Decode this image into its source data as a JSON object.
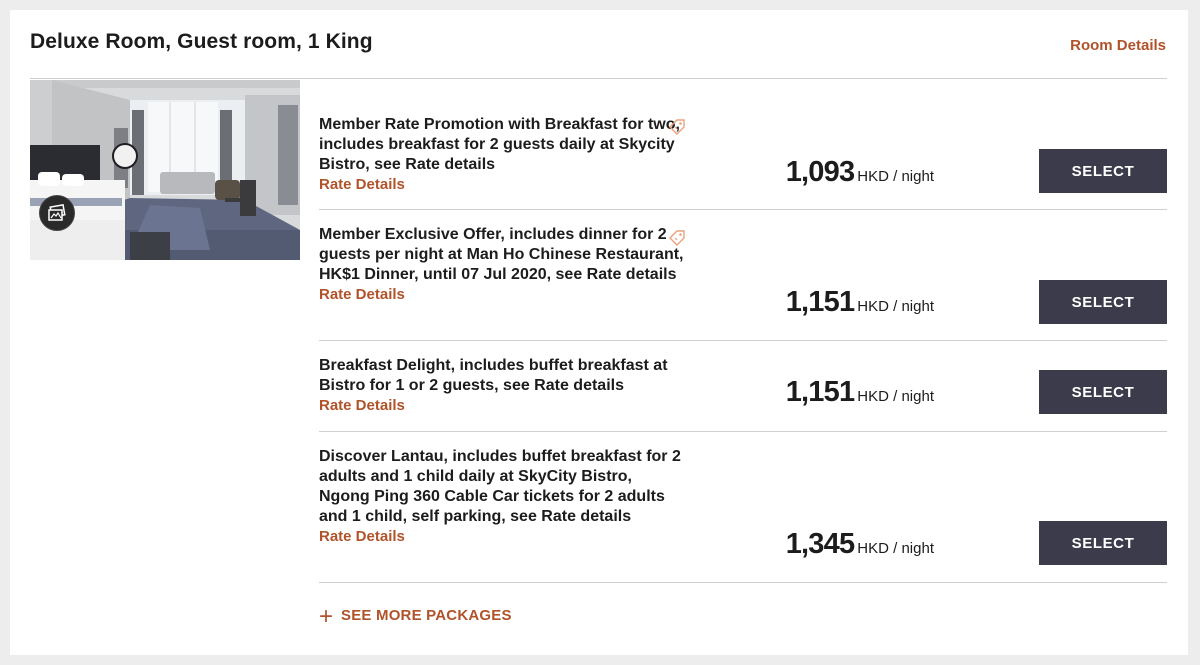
{
  "room": {
    "title": "Deluxe Room, Guest room, 1 King",
    "details_link": "Room Details",
    "photo_icon": "gallery-icon"
  },
  "rates": [
    {
      "description": "Member Rate Promotion with Breakfast for two, includes breakfast for 2 guests daily at Skycity Bistro, see Rate details",
      "link": "Rate Details",
      "has_tag": true,
      "price": "1,093",
      "unit": "HKD / night",
      "button": "SELECT"
    },
    {
      "description": "Member Exclusive Offer, includes dinner for 2 guests per night at Man Ho Chinese Restaurant, HK$1 Dinner, until 07 Jul 2020, see Rate details",
      "link": "Rate Details",
      "has_tag": true,
      "price": "1,151",
      "unit": "HKD / night",
      "button": "SELECT"
    },
    {
      "description": "Breakfast Delight, includes buffet breakfast at Bistro for 1 or 2 guests, see Rate details",
      "link": "Rate Details",
      "has_tag": false,
      "price": "1,151",
      "unit": "HKD / night",
      "button": "SELECT"
    },
    {
      "description": "Discover Lantau, includes buffet breakfast for 2 adults and 1 child daily at SkyCity Bistro, Ngong Ping 360 Cable Car tickets for 2 adults and 1 child, self parking, see Rate details",
      "link": "Rate Details",
      "has_tag": false,
      "price": "1,345",
      "unit": "HKD / night",
      "button": "SELECT"
    }
  ],
  "see_more": {
    "icon": "plus-icon",
    "label": "SEE MORE PACKAGES"
  },
  "colors": {
    "accent": "#b0532a",
    "button": "#3c3b4c",
    "tag": "#e8a27c",
    "divider": "#cfcfcf"
  }
}
